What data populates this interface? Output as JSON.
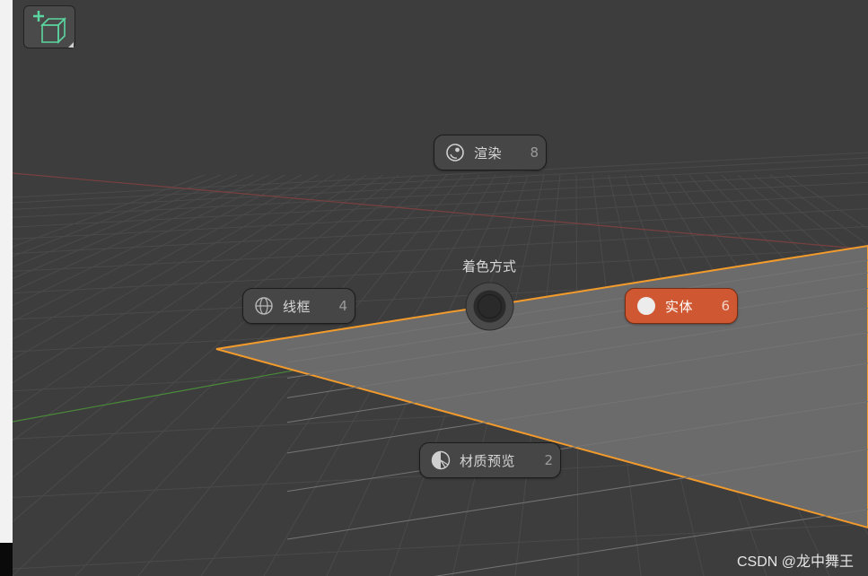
{
  "pie_menu": {
    "title": "着色方式",
    "items": [
      {
        "id": "render",
        "label": "渲染",
        "key": "8",
        "icon": "render-sphere-icon",
        "active": false
      },
      {
        "id": "wireframe",
        "label": "线框",
        "key": "4",
        "icon": "wireframe-globe-icon",
        "active": false
      },
      {
        "id": "solid",
        "label": "实体",
        "key": "6",
        "icon": "solid-circle-icon",
        "active": true
      },
      {
        "id": "material",
        "label": "材质预览",
        "key": "2",
        "icon": "material-preview-icon",
        "active": false
      }
    ]
  },
  "toolbar": {
    "add_icon": "add-cube-icon"
  },
  "watermark": "CSDN @龙中舞王",
  "colors": {
    "background": "#3d3d3d",
    "active_accent": "#cf5731",
    "selection_outline": "#f29b2c",
    "x_axis": "#8a4545",
    "y_axis": "#4f8a3c",
    "plane_fill": "#6a6a6a"
  }
}
